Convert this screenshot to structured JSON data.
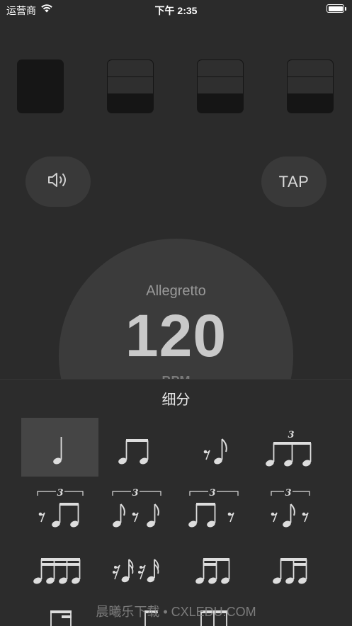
{
  "status": {
    "carrier": "运营商",
    "time": "下午 2:35"
  },
  "controls": {
    "sound_icon": "speaker-icon",
    "tap_label": "TAP"
  },
  "tempo": {
    "name": "Allegretto",
    "bpm": "120",
    "unit": "BPM"
  },
  "beats": [
    {
      "index": 1,
      "state": "accent"
    },
    {
      "index": 2,
      "state": "normal"
    },
    {
      "index": 3,
      "state": "normal"
    },
    {
      "index": 4,
      "state": "normal"
    }
  ],
  "subdivision": {
    "title": "细分",
    "selected": "quarter",
    "options": [
      "quarter",
      "two-eighths",
      "eighth-rest-eighth",
      "eighth-triplet",
      "triplet-rest-two",
      "triplet-eighth-rest-eighth",
      "triplet-two-rest",
      "triplet-rest-eighth-rest",
      "four-sixteenths",
      "sixteenth-rest-pairs",
      "sixteenth-eighth",
      "eighth-sixteenth"
    ]
  },
  "watermark": "晨曦乐下载 • CXLEDU.COM",
  "colors": {
    "background": "#2b2b2b",
    "dial": "#3b3b3b",
    "button": "#393939",
    "selected": "#454545"
  }
}
